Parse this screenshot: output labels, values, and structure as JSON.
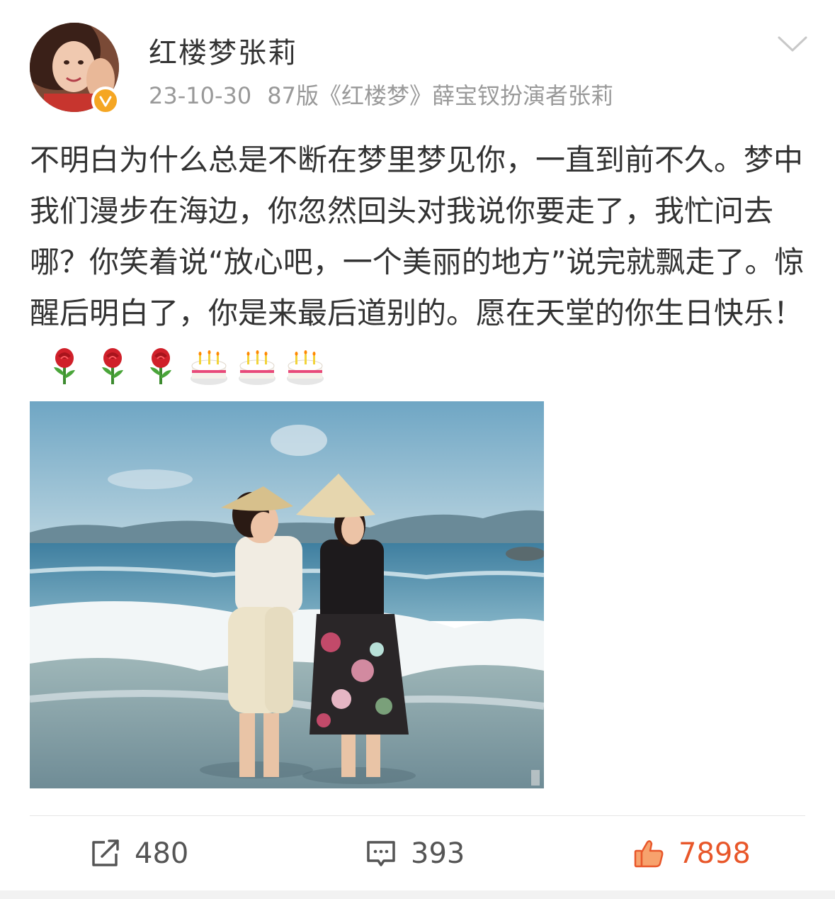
{
  "user": {
    "name": "红楼梦张莉",
    "verified": true
  },
  "post": {
    "date": "23-10-30",
    "bio": "87版《红楼梦》薛宝钗扮演者张莉",
    "text": "不明白为什么总是不断在梦里梦见你，一直到前不久。梦中我们漫步在海边，你忽然回头对我说你要走了，我忙问去哪？你笑着说“放心吧，一个美丽的地方”说完就飘走了。惊醒后明白了，你是来最后道别的。愿在天堂的你生日快乐！",
    "emojis": [
      "rose-icon",
      "rose-icon",
      "rose-icon",
      "cake-icon",
      "cake-icon",
      "cake-icon"
    ]
  },
  "actions": {
    "repost_count": "480",
    "comment_count": "393",
    "like_count": "7898"
  },
  "colors": {
    "text": "#333333",
    "meta": "#999999",
    "like": "#e8572a",
    "verified": "#f5a623"
  }
}
